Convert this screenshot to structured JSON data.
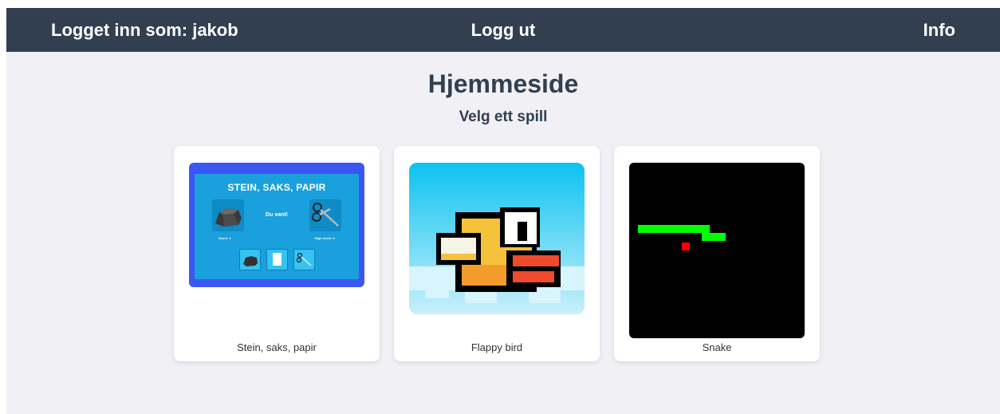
{
  "header": {
    "logged_in": "Logget inn som: jakob",
    "logout": "Logg ut",
    "info": "Info"
  },
  "title": "Hjemmeside",
  "subtitle": "Velg ett spill",
  "games": [
    {
      "label": "Stein, saks, papir",
      "thumb": {
        "title": "STEIN, SAKS, PAPIR",
        "result": "Du vant!",
        "score": "Score: 1",
        "high_score": "High score: 1"
      }
    },
    {
      "label": "Flappy bird"
    },
    {
      "label": "Snake"
    }
  ],
  "colors": {
    "header_bg": "#323f50",
    "page_bg": "#f0f0f5",
    "rps_frame": "#3b57f2",
    "rps_panel": "#1aa0dc",
    "snake_body": "#00ff00",
    "snake_food": "#ff0000"
  }
}
